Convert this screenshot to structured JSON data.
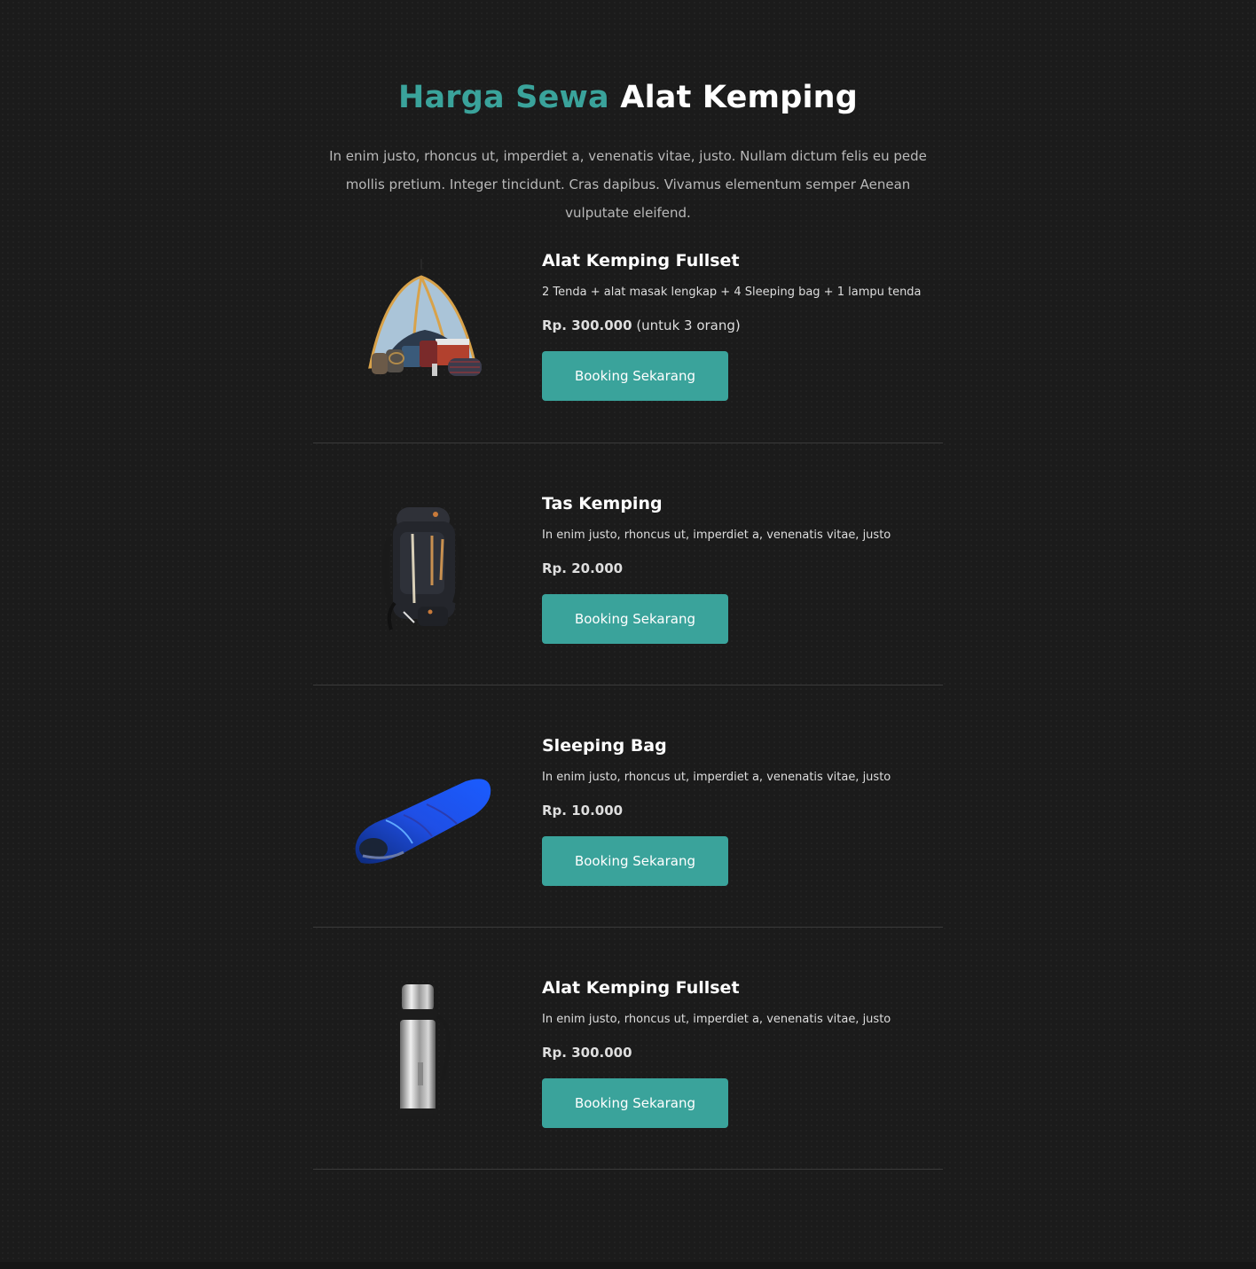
{
  "header": {
    "title_accent": "Harga Sewa",
    "title_rest": "Alat Kemping",
    "intro": "In enim justo, rhoncus ut, imperdiet a, venenatis vitae, justo. Nullam dictum felis eu pede mollis pretium. Integer tincidunt. Cras dapibus. Vivamus elementum semper Aenean vulputate eleifend."
  },
  "colors": {
    "accent": "#3aa39b",
    "background": "#1b1b1b"
  },
  "products": [
    {
      "name": "Alat Kemping Fullset",
      "description": "2 Tenda + alat masak lengkap + 4 Sleeping bag + 1 lampu tenda",
      "price": "Rp. 300.000",
      "price_note": "(untuk 3 orang)",
      "button": "Booking Sekarang",
      "image_icon": "tent-icon"
    },
    {
      "name": "Tas Kemping",
      "description": "In enim justo, rhoncus ut, imperdiet a, venenatis vitae, justo",
      "price": "Rp. 20.000",
      "price_note": "",
      "button": "Booking Sekarang",
      "image_icon": "backpack-icon"
    },
    {
      "name": "Sleeping Bag",
      "description": "In enim justo, rhoncus ut, imperdiet a, venenatis vitae, justo",
      "price": "Rp. 10.000",
      "price_note": "",
      "button": "Booking Sekarang",
      "image_icon": "sleeping-bag-icon"
    },
    {
      "name": "Alat Kemping Fullset",
      "description": "In enim justo, rhoncus ut, imperdiet a, venenatis vitae, justo",
      "price": "Rp. 300.000",
      "price_note": "",
      "button": "Booking Sekarang",
      "image_icon": "thermos-icon"
    }
  ]
}
